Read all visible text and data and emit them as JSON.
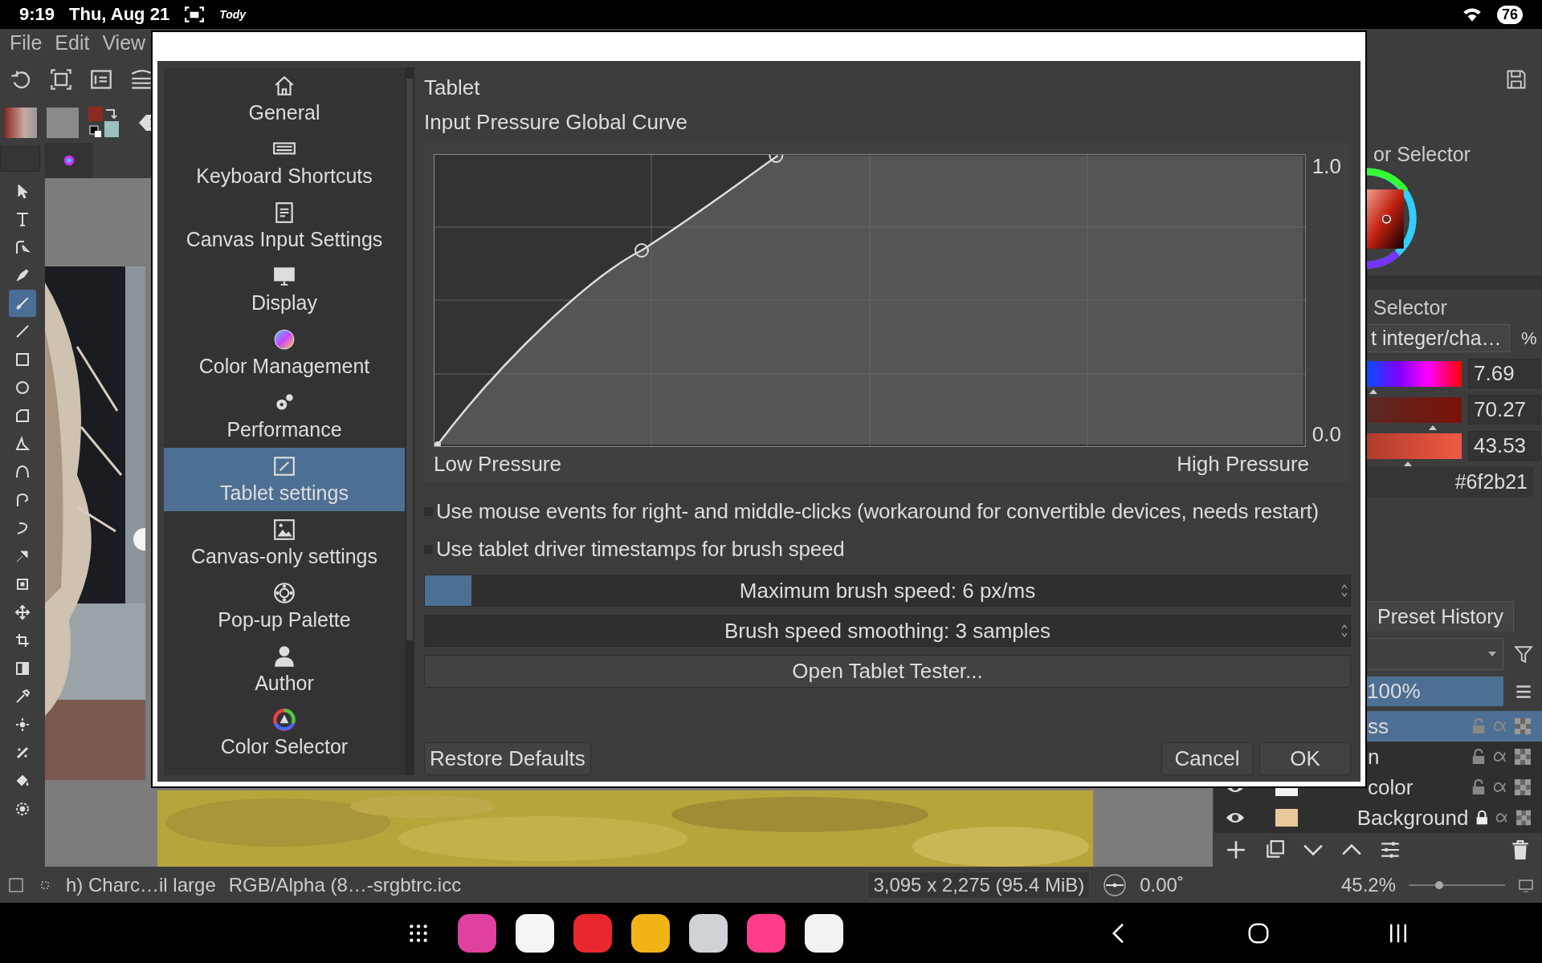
{
  "status_bar": {
    "time": "9:19",
    "date": "Thu, Aug 21",
    "app_label": "Tody",
    "battery": "76"
  },
  "menu": [
    {
      "label": "File"
    },
    {
      "label": "Edit"
    },
    {
      "label": "View"
    }
  ],
  "toolbox": [
    {
      "kind": "pointer",
      "selected": false
    },
    {
      "kind": "text",
      "selected": false
    },
    {
      "kind": "edit-shape",
      "selected": false
    },
    {
      "kind": "calligraphy",
      "selected": false
    },
    {
      "kind": "brush",
      "selected": true
    },
    {
      "kind": "line",
      "selected": false
    },
    {
      "kind": "rect",
      "selected": false
    },
    {
      "kind": "ellipse",
      "selected": false
    },
    {
      "kind": "polygon",
      "selected": false
    },
    {
      "kind": "polyline",
      "selected": false
    },
    {
      "kind": "bezier",
      "selected": false
    },
    {
      "kind": "path",
      "selected": false
    },
    {
      "kind": "freehand",
      "selected": false
    },
    {
      "kind": "multibrush",
      "selected": false
    },
    {
      "kind": "transform",
      "selected": false
    },
    {
      "kind": "move",
      "selected": false
    },
    {
      "kind": "crop",
      "selected": false
    },
    {
      "kind": "gradient",
      "selected": false
    },
    {
      "kind": "picker",
      "selected": false
    },
    {
      "kind": "smart-patch",
      "selected": false
    },
    {
      "kind": "assistant",
      "selected": false
    },
    {
      "kind": "fill",
      "selected": false
    },
    {
      "kind": "enclose",
      "selected": false
    }
  ],
  "dialog": {
    "pages": [
      {
        "label": "General",
        "selected": false
      },
      {
        "label": "Keyboard Shortcuts",
        "selected": false
      },
      {
        "label": "Canvas Input Settings",
        "selected": false
      },
      {
        "label": "Display",
        "selected": false
      },
      {
        "label": "Color Management",
        "selected": false
      },
      {
        "label": "Performance",
        "selected": false
      },
      {
        "label": "Tablet settings",
        "selected": true
      },
      {
        "label": "Canvas-only settings",
        "selected": false
      },
      {
        "label": "Pop-up Palette",
        "selected": false
      },
      {
        "label": "Author",
        "selected": false
      },
      {
        "label": "Color Selector",
        "selected": false
      }
    ],
    "page_title": "Tablet",
    "curve": {
      "title": "Input Pressure Global Curve",
      "y_max": "1.0",
      "y_min": "0.0",
      "x_min": "Low Pressure",
      "x_max": "High Pressure"
    },
    "options": [
      {
        "label": "Use mouse events for right- and middle-clicks (workaround for convertible devices, needs restart)",
        "checked": false
      },
      {
        "label": "Use tablet driver timestamps for brush speed",
        "checked": false
      }
    ],
    "sliders": [
      {
        "label": "Maximum brush speed: 6 px/ms",
        "level": 0.05
      },
      {
        "label": "Brush speed smoothing: 3 samples"
      }
    ],
    "tester_button": "Open Tablet Tester...",
    "buttons": {
      "restore": "Restore Defaults",
      "cancel": "Cancel",
      "ok": "OK"
    }
  },
  "color_docker": {
    "title": "or Selector",
    "title2": "Selector",
    "model": "t integer/cha…",
    "unit": "%",
    "channels": [
      {
        "value": "7.69",
        "level": 0.08
      },
      {
        "value": "70.27",
        "level": 0.7
      },
      {
        "value": "43.53",
        "level": 0.44
      }
    ],
    "hex": "#6f2b21"
  },
  "preset_tab": "Preset History",
  "layers": {
    "opacity": {
      "text": "100%",
      "level": 1
    },
    "rows": [
      {
        "name": "ss",
        "selected": true,
        "locked": false
      },
      {
        "name": "n",
        "selected": false,
        "locked": false
      },
      {
        "name": "color",
        "selected": false,
        "locked": false
      },
      {
        "name": "Background",
        "selected": false,
        "locked": true
      }
    ]
  },
  "krita_status": {
    "document": "h) Charc…il large",
    "color_space": "RGB/Alpha (8…-srgbtrc.icc",
    "size": "3,095 x 2,275 (95.4 MiB)",
    "rotation": "0.00˚",
    "zoom": "45.2%",
    "zoom_slider": {
      "level": 0.3
    }
  },
  "dock_apps": [
    {
      "color": "#e040a0"
    },
    {
      "color": "#f4f4f4"
    },
    {
      "color": "#e8282c"
    },
    {
      "color": "#f2b316"
    },
    {
      "color": "#cfd3d8"
    },
    {
      "color": "#ff3d8c"
    },
    {
      "color": "#f2f2f2"
    }
  ]
}
